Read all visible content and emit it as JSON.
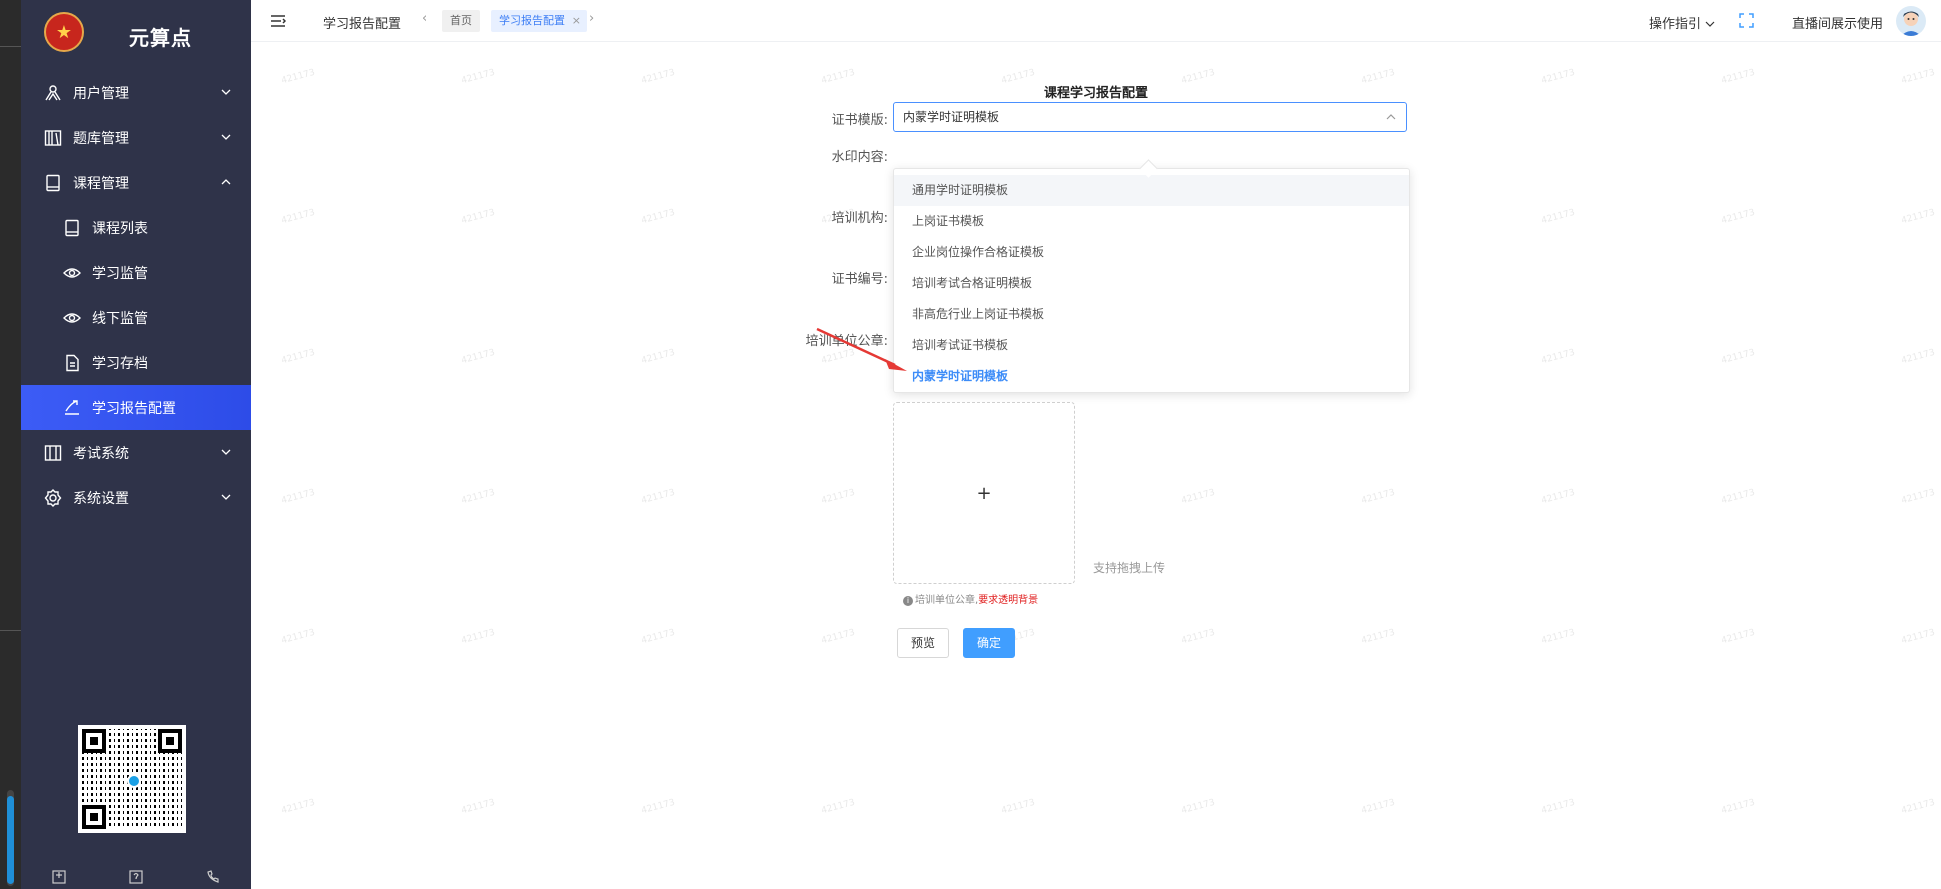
{
  "sidebar": {
    "brand": "元算点",
    "items": [
      {
        "label": "用户管理",
        "icon": "users-icon"
      },
      {
        "label": "题库管理",
        "icon": "library-icon"
      },
      {
        "label": "课程管理",
        "icon": "book-icon"
      },
      {
        "label": "课程列表",
        "icon": "book-icon"
      },
      {
        "label": "学习监管",
        "icon": "eye-icon"
      },
      {
        "label": "线下监管",
        "icon": "eye-icon"
      },
      {
        "label": "学习存档",
        "icon": "document-icon"
      },
      {
        "label": "学习报告配置",
        "icon": "report-icon"
      },
      {
        "label": "考试系统",
        "icon": "exam-icon"
      },
      {
        "label": "系统设置",
        "icon": "gear-icon"
      }
    ],
    "active_item": "学习报告配置"
  },
  "topbar": {
    "page_title": "学习报告配置",
    "tabs": [
      "首页",
      "学习报告配置"
    ],
    "guide": "操作指引",
    "user": "直播间展示使用"
  },
  "watermark": "421173",
  "form": {
    "title": "课程学习报告配置",
    "labels": {
      "template": "证书模版:",
      "watermark": "水印内容:",
      "org": "培训机构:",
      "cert_no": "证书编号:",
      "stamp": "培训单位公章:"
    },
    "template_value": "内蒙学时证明模板",
    "template_options": [
      "通用学时证明模板",
      "上岗证书模板",
      "企业岗位操作合格证模板",
      "培训考试合格证明模板",
      "非高危行业上岗证书模板",
      "培训考试证书模板",
      "内蒙学时证明模板"
    ],
    "upload_plus": "+",
    "upload_hint": "支持拖拽上传",
    "stamp_note": "培训单位公章,",
    "stamp_note_red": "要求透明背景",
    "preview_btn": "预览",
    "confirm_btn": "确定"
  },
  "colors": {
    "sidebar_bg": "#2f3349",
    "active_bg": "#3c5cf6",
    "accent": "#409eff",
    "selected_option": "#3c8cf8",
    "annotation_arrow": "#e53935"
  }
}
